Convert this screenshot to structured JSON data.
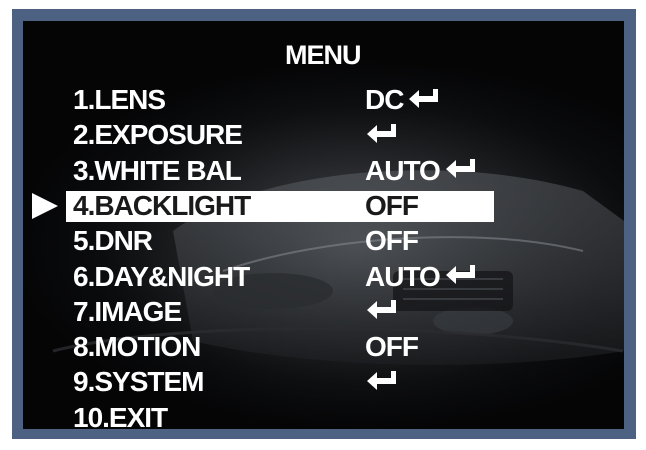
{
  "menu": {
    "title": "MENU",
    "selected_index": 3,
    "items": [
      {
        "label": "1.LENS",
        "value": "DC",
        "enter_icon": true
      },
      {
        "label": "2.EXPOSURE",
        "value": "",
        "enter_icon": true
      },
      {
        "label": "3.WHITE BAL",
        "value": "AUTO",
        "enter_icon": true
      },
      {
        "label": "4.BACKLIGHT",
        "value": "OFF",
        "enter_icon": false
      },
      {
        "label": "5.DNR",
        "value": "OFF",
        "enter_icon": false
      },
      {
        "label": "6.DAY&NIGHT",
        "value": "AUTO",
        "enter_icon": true
      },
      {
        "label": "7.IMAGE",
        "value": "",
        "enter_icon": true
      },
      {
        "label": "8.MOTION",
        "value": "OFF",
        "enter_icon": false
      },
      {
        "label": "9.SYSTEM",
        "value": "",
        "enter_icon": true
      },
      {
        "label": "10.EXIT",
        "value": "",
        "enter_icon": false
      }
    ]
  },
  "icons": {
    "cursor": "selection-arrow-icon",
    "enter": "enter-return-icon"
  },
  "colors": {
    "border": "#4d6282",
    "text": "#ffffff",
    "highlight_bg": "#ffffff",
    "highlight_text": "#1a1a1a"
  }
}
